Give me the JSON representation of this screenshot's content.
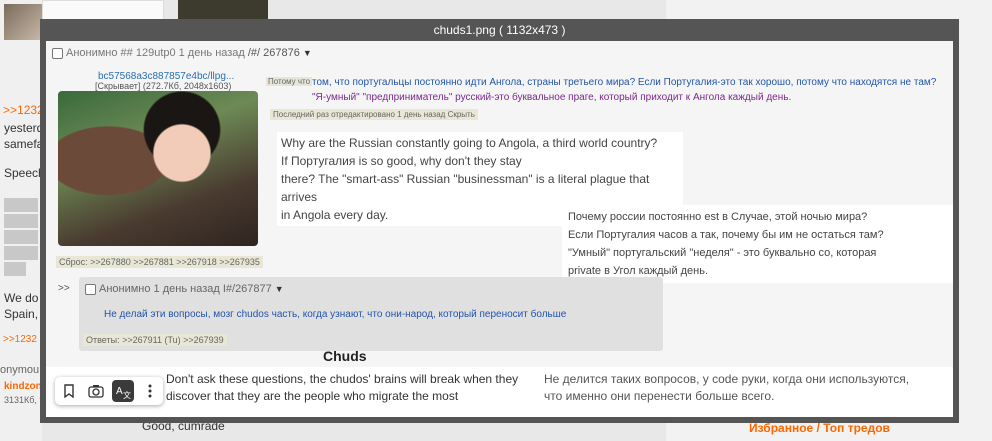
{
  "viewer": {
    "title": "chuds1.png ( 1132x473 )"
  },
  "background": {
    "left_texts": [
      ">>1232",
      "yesterd",
      "samefa",
      "Speech",
      "We do",
      "Spain,",
      ">>1232"
    ],
    "bottom_user": "onymou",
    "bottom_user2": "kindzony",
    "bottom_meta": "3131Кб, 9",
    "bottom_reply": "Good, cumrade",
    "bottom_links": "Избранное / Топ тредов"
  },
  "post": {
    "header_name": "Анонимно ## 129utp0",
    "header_date": "1 день назад",
    "header_num": "/#/ 267876",
    "file_link": "bc57568a3c887857e4bc/llpg...",
    "file_meta": "[Скрывает] (272.7Кб, 2048x1603)",
    "tag_small": "Потому что",
    "line1": "том, что португальцы постоянно идти Ангола, страны третьего мира? Если Португалия-это так хорошо, потому что находятся не там?",
    "line2": "\"Я-умный\" \"предприниматель\" русский-это буквальное праге, который приходит к Ангола каждый день.",
    "edited": "Последний раз отредактировано 1 день назад Скрыть",
    "replies": "Сброс: >>267880 >>267881 >>267918 >>267935"
  },
  "translation_en": {
    "l1": "Why are the Russian constantly going to Angola, a third world country?",
    "l2": "If Португалия is so good, why don't they stay",
    "l3": "there? The \"smart-ass\" Russian \"businessman\" is a literal plague that arrives",
    "l4": "in Angola every day."
  },
  "translation_ru": {
    "l1": "Почему россии постоянно est в Случае, этой ночью мира?",
    "l2": "Если Португалия часов а так, почему бы им не остаться там?",
    "l3": "\"Умный\" португальский \"неделя\" - это буквально со, которая",
    "l4": "private в Угол каждый день."
  },
  "reply": {
    "arrow": ">>",
    "header": "Анонимно 1 день назад I#/267877",
    "body": "Не делай эти вопросы, мозг chudos часть, когда узнают, что они-народ, который переносит больше",
    "replies": "Ответы: >>267911 (Tu) >>267939"
  },
  "bottom": {
    "title": "Chuds",
    "en1": "Don't ask these questions, the chudos' brains will break when they",
    "en2": "discover that they are the people who migrate the most",
    "ru1": "Не делится таких вопросов, у code руки, когда они используются,",
    "ru2": "что именно они перенести больше всего."
  },
  "toolbar": {
    "icons": [
      "bookmark-icon",
      "camera-icon",
      "translate-icon",
      "more-vertical-icon"
    ],
    "active": "translate-icon"
  }
}
